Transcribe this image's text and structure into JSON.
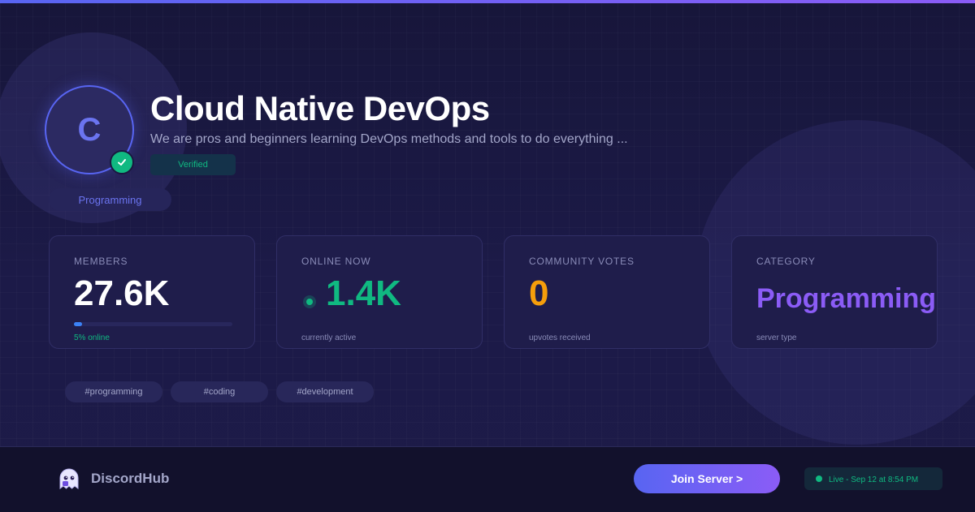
{
  "server": {
    "initial": "C",
    "name": "Cloud Native DevOps",
    "description": "We are pros and beginners learning DevOps methods and tools to do everything ...",
    "verified_label": "Verified",
    "category_pill": "Programming"
  },
  "stats": {
    "members": {
      "label": "MEMBERS",
      "value": "27.6K",
      "online_fraction": 0.05,
      "sub": "5% online"
    },
    "online": {
      "label": "ONLINE NOW",
      "value": "1.4K",
      "sub": "currently active"
    },
    "votes": {
      "label": "COMMUNITY VOTES",
      "value": "0",
      "sub": "upvotes received"
    },
    "category": {
      "label": "CATEGORY",
      "value": "Programming",
      "sub": "server type"
    }
  },
  "tags": [
    "#programming",
    "#coding",
    "#development"
  ],
  "footer": {
    "brand": "DiscordHub",
    "join_label": "Join Server >",
    "live_label": "Live - Sep 12 at 8:54 PM"
  },
  "colors": {
    "accent": "#5865f2",
    "accent2": "#8b5cf6",
    "online": "#10b981",
    "votes": "#f59e0b",
    "category": "#8b5cf6"
  },
  "icons": {
    "verified_badge": "check-icon",
    "brand": "ghost-icon",
    "online": "dot-icon"
  }
}
